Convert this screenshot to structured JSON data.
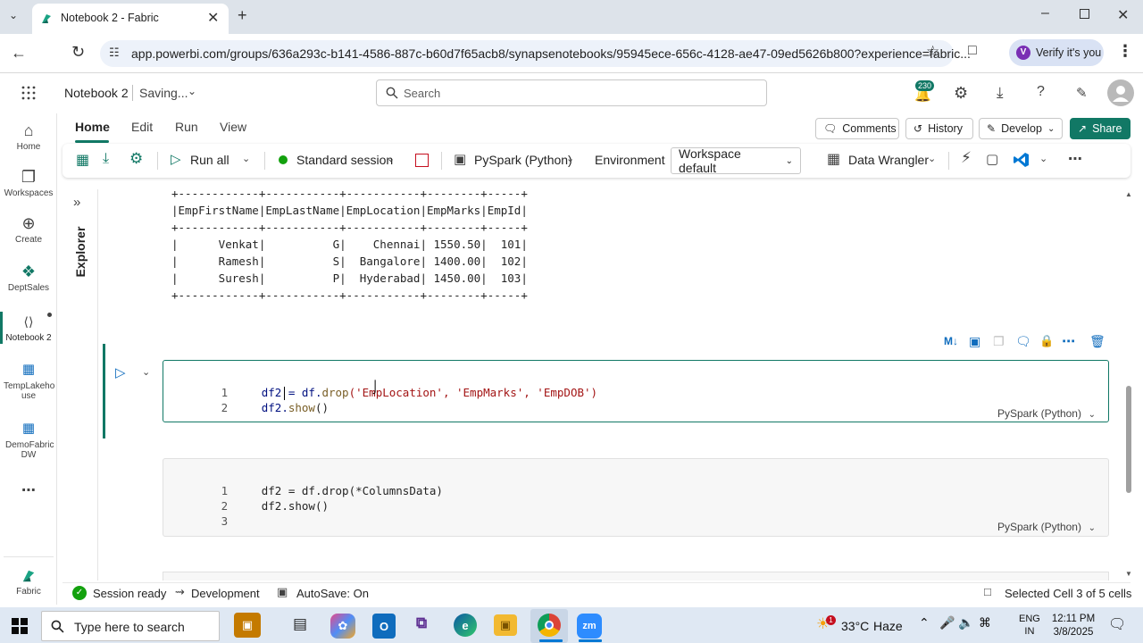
{
  "browser": {
    "tab_title": "Notebook 2 - Fabric",
    "url": "app.powerbi.com/groups/636a293c-b141-4586-887c-b60d7f65acb8/synapsenotebooks/95945ece-656c-4128-ae47-09ed5626b800?experience=fabric...",
    "verify_label": "Verify it's you",
    "avatar_letter": "V"
  },
  "app_header": {
    "notebook_name": "Notebook 2",
    "status": "Saving...",
    "search_placeholder": "Search",
    "notifications_count": "230"
  },
  "ribbon": {
    "tabs": [
      "Home",
      "Edit",
      "Run",
      "View"
    ],
    "active_tab": "Home",
    "comments_label": "Comments",
    "history_label": "History",
    "develop_label": "Develop",
    "share_label": "Share",
    "run_all_label": "Run all",
    "session_label": "Standard session",
    "language_label": "PySpark (Python)",
    "environment_label": "Environment",
    "workspace_label": "Workspace default",
    "data_wrangler_label": "Data Wrangler"
  },
  "left_rail": [
    {
      "label": "Home",
      "icon": "home-icon"
    },
    {
      "label": "Workspaces",
      "icon": "workspaces-icon"
    },
    {
      "label": "Create",
      "icon": "create-icon"
    },
    {
      "label": "DeptSales",
      "icon": "deptsales-icon"
    },
    {
      "label": "Notebook 2",
      "icon": "notebook-icon"
    },
    {
      "label": "TempLakeho use",
      "icon": "lakehouse-icon"
    },
    {
      "label": "DemoFabric DW",
      "icon": "warehouse-icon"
    }
  ],
  "rail_footer_label": "Fabric",
  "explorer_label": "Explorer",
  "output_table": [
    "+------------+-----------+-----------+--------+-----+",
    "|EmpFirstName|EmpLastName|EmpLocation|EmpMarks|EmpId|",
    "+------------+-----------+-----------+--------+-----+",
    "|      Venkat|          G|    Chennai| 1550.50|  101|",
    "|      Ramesh|          S|  Bangalore| 1400.00|  102|",
    "|      Suresh|          P|  Hyderabad| 1450.00|  103|",
    "+------------+-----------+-----------+--------+-----+"
  ],
  "cell_active": {
    "lines": [
      {
        "num": "1",
        "pre": "df2 = df.",
        "fn": "drop",
        "args": "('EmpLocation', 'EmpMarks', 'EmpDOB')"
      },
      {
        "num": "2",
        "pre": "df2.",
        "fn": "show",
        "args": "()"
      }
    ],
    "lang": "PySpark (Python)"
  },
  "cell_next": {
    "lines": [
      {
        "num": "1",
        "text": "df2 = df.drop(*ColumnsData)"
      },
      {
        "num": "2",
        "text": "df2.show()"
      },
      {
        "num": "3",
        "text": ""
      }
    ],
    "lang": "PySpark (Python)"
  },
  "status_bar": {
    "session": "Session ready",
    "mode": "Development",
    "autosave": "AutoSave: On",
    "selection": "Selected Cell 3 of 5 cells"
  },
  "taskbar": {
    "search_placeholder": "Type here to search",
    "temperature": "33°C",
    "weather": "Haze",
    "lang_line1": "ENG",
    "lang_line2": "IN",
    "time": "12:11 PM",
    "date": "3/8/2025",
    "weather_badge": "1"
  },
  "colors": {
    "accent": "#117865",
    "share_bg": "#117865",
    "tabstrip": "#dde3ea",
    "session_dot": "#13a10e"
  }
}
